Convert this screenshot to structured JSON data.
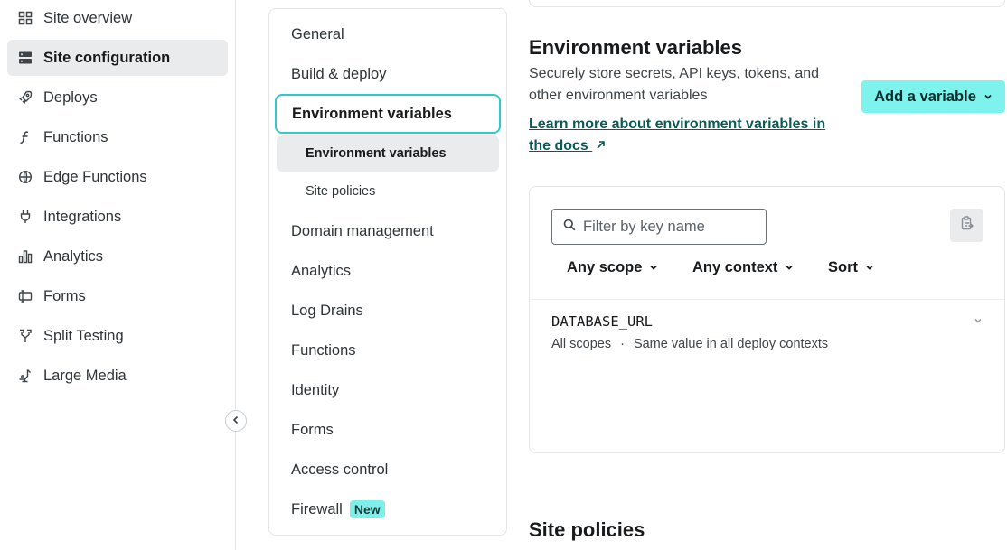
{
  "app_nav": {
    "items": [
      {
        "label": "Site overview",
        "icon": "grid-icon"
      },
      {
        "label": "Site configuration",
        "icon": "server-icon"
      },
      {
        "label": "Deploys",
        "icon": "rocket-icon"
      },
      {
        "label": "Functions",
        "icon": "function-icon"
      },
      {
        "label": "Edge Functions",
        "icon": "globe-icon"
      },
      {
        "label": "Integrations",
        "icon": "plug-icon"
      },
      {
        "label": "Analytics",
        "icon": "bar-chart-icon"
      },
      {
        "label": "Forms",
        "icon": "form-icon"
      },
      {
        "label": "Split Testing",
        "icon": "split-icon"
      },
      {
        "label": "Large Media",
        "icon": "media-icon"
      }
    ],
    "active_index": 1
  },
  "settings_nav": {
    "items": [
      "General",
      "Build & deploy",
      "Environment variables",
      "Domain management",
      "Analytics",
      "Log Drains",
      "Functions",
      "Identity",
      "Forms",
      "Access control",
      "Firewall"
    ],
    "current": "Environment variables",
    "sub_items": [
      "Environment variables",
      "Site policies"
    ],
    "firewall_badge": "New"
  },
  "env_section": {
    "title": "Environment variables",
    "description": "Securely store secrets, API keys, tokens, and other environment variables",
    "docs_link": "Learn more about environment variables in the docs",
    "add_button": "Add a variable"
  },
  "vars_panel": {
    "filter_placeholder": "Filter by key name",
    "filters": [
      "Any scope",
      "Any context",
      "Sort"
    ],
    "variables": [
      {
        "key": "DATABASE_URL",
        "scope": "All scopes",
        "context": "Same value in all deploy contexts"
      }
    ]
  },
  "policies_section": {
    "title": "Site policies"
  },
  "colors": {
    "accent_border": "#30c8c9",
    "primary_button": "#7ef3ee",
    "link": "#0b5a57",
    "badge": "#7eefe9"
  }
}
